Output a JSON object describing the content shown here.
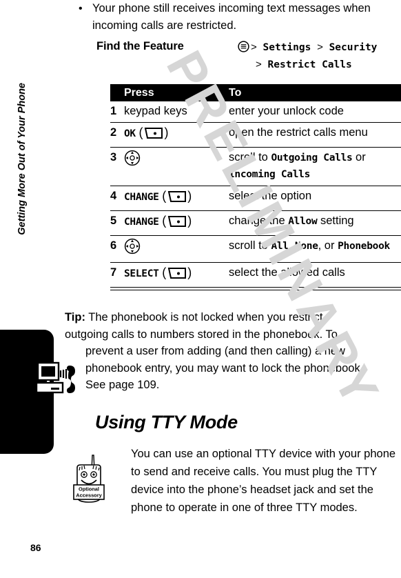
{
  "page": {
    "number": "86",
    "chapter_title": "Getting More Out of Your Phone",
    "watermark": "PRELIMINARY"
  },
  "icons": {
    "tty": "tty-icon",
    "menu": "menu-icon",
    "softkey": "softkey-icon",
    "navigation": "navigation-key-icon",
    "optional_accessory": "optional-accessory-icon",
    "optional_accessory_line1": "Optional",
    "optional_accessory_line2": "Accessory"
  },
  "bullet": {
    "marker": "•",
    "text": "Your phone still receives incoming text messages when incoming calls are restricted."
  },
  "find_feature": {
    "label": "Find the Feature",
    "path_line1_a": "Settings",
    "path_line1_b": "Security",
    "path_line2": "Restrict Calls",
    "separator": ">"
  },
  "table": {
    "headers": {
      "num": "",
      "press": "Press",
      "to": "To"
    },
    "rows": [
      {
        "num": "1",
        "press_text": "keypad keys",
        "press_key": "",
        "press_has_softkey": false,
        "to_parts": [
          {
            "t": "enter your unlock code",
            "b": false
          }
        ]
      },
      {
        "num": "2",
        "press_text": "OK",
        "press_has_softkey": true,
        "to_parts": [
          {
            "t": "open the restrict calls menu",
            "b": false
          }
        ]
      },
      {
        "num": "3",
        "press_text": "",
        "press_has_nav": true,
        "press_has_softkey": false,
        "to_parts": [
          {
            "t": "scroll to ",
            "b": false
          },
          {
            "t": "Outgoing Calls",
            "b": true
          },
          {
            "t": " or ",
            "b": false
          },
          {
            "t": "Incoming Calls",
            "b": true
          }
        ]
      },
      {
        "num": "4",
        "press_text": "CHANGE",
        "press_has_softkey": true,
        "to_parts": [
          {
            "t": "select the option",
            "b": false
          }
        ]
      },
      {
        "num": "5",
        "press_text": "CHANGE",
        "press_has_softkey": true,
        "to_parts": [
          {
            "t": "change the ",
            "b": false
          },
          {
            "t": "Allow",
            "b": true
          },
          {
            "t": " setting",
            "b": false
          }
        ]
      },
      {
        "num": "6",
        "press_text": "",
        "press_has_nav": true,
        "press_has_softkey": false,
        "to_parts": [
          {
            "t": "scroll to ",
            "b": false
          },
          {
            "t": "All",
            "b": true
          },
          {
            "t": ", ",
            "b": false
          },
          {
            "t": "None",
            "b": true
          },
          {
            "t": ", or ",
            "b": false
          },
          {
            "t": "Phonebook",
            "b": true
          }
        ]
      },
      {
        "num": "7",
        "press_text": "SELECT",
        "press_has_softkey": true,
        "to_parts": [
          {
            "t": "select the allowed calls",
            "b": false
          }
        ]
      }
    ]
  },
  "tip": {
    "lead": "Tip:",
    "line1": " The phonebook is not locked when you restrict",
    "line2": "outgoing calls to numbers stored in the phonebook. To",
    "line3": "prevent a user from adding (and then calling) a new",
    "line4": "phonebook entry, you may want to lock the phonebook.",
    "line5": "See page 109."
  },
  "tty_section": {
    "heading": "Using TTY Mode",
    "body": "You can use an optional TTY device with your phone to send and receive calls. You must plug the TTY device into the phone’s headset jack and set the phone to operate in one of three TTY modes."
  },
  "colors": {
    "ink": "#000000",
    "paper": "#ffffff",
    "watermark": "#d6d6d6"
  }
}
